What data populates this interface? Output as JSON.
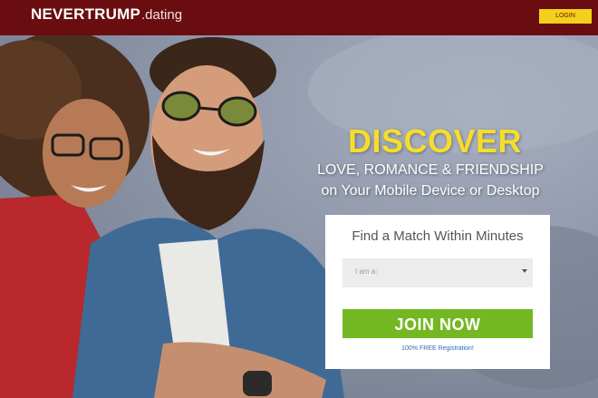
{
  "header": {
    "logo_brand": "NEVERTRUMP",
    "logo_suffix": ".dating",
    "login_label": "LOGIN"
  },
  "hero": {
    "headline": "DISCOVER",
    "tagline_line1": "LOVE, ROMANCE & FRIENDSHIP",
    "tagline_line2": "on Your Mobile Device or Desktop"
  },
  "signup_card": {
    "title": "Find a Match Within Minutes",
    "select_placeholder": "I am a:",
    "join_label": "JOIN NOW",
    "free_note": "100% FREE Registration!"
  },
  "colors": {
    "header_bg": "#6a0d10",
    "login_bg": "#f3d01c",
    "headline": "#f5dd2b",
    "join_bg": "#73b823",
    "free_note": "#2f6fae"
  },
  "icons": {
    "select_caret": "chevron-down-icon"
  }
}
